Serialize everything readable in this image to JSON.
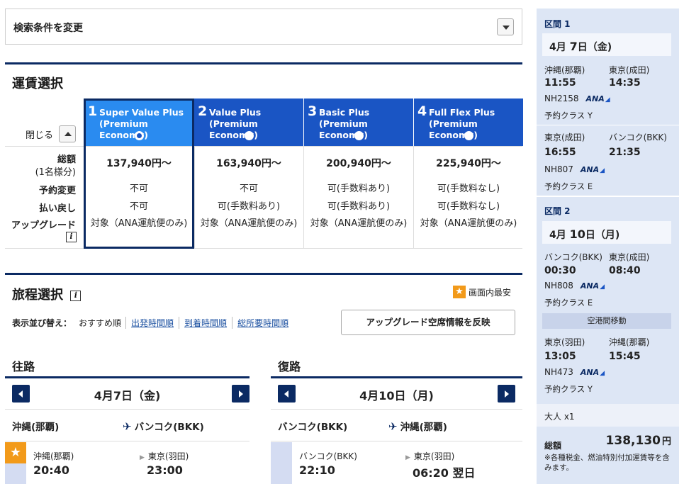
{
  "search": {
    "label": "検索条件を変更"
  },
  "fare_section": {
    "title": "運賃選択",
    "close_label": "閉じる",
    "row_labels": [
      "総額",
      "(1名様分)",
      "予約変更",
      "払い戻し",
      "アップグレード"
    ],
    "fares": [
      {
        "num": "1",
        "name": "Super Value Plus (Premium Economy)",
        "price": "137,940円〜",
        "change": "不可",
        "refund": "不可",
        "upgrade": "対象（ANA運航便のみ)",
        "selected": true
      },
      {
        "num": "2",
        "name": "Value Plus (Premium Economy)",
        "price": "163,940円〜",
        "change": "不可",
        "refund": "可(手数料あり)",
        "upgrade": "対象（ANA運航便のみ)",
        "selected": false
      },
      {
        "num": "3",
        "name": "Basic Plus (Premium Economy)",
        "price": "200,940円〜",
        "change": "可(手数料あり)",
        "refund": "可(手数料あり)",
        "upgrade": "対象（ANA運航便のみ)",
        "selected": false
      },
      {
        "num": "4",
        "name": "Full Flex Plus (Premium Economy)",
        "price": "225,940円〜",
        "change": "可(手数料なし)",
        "refund": "可(手数料なし)",
        "upgrade": "対象（ANA運航便のみ)",
        "selected": false
      }
    ]
  },
  "itinerary": {
    "title": "旅程選択",
    "cheapest_label": "画面内最安",
    "sort_label": "表示並び替え：",
    "sort_current": "おすすめ順",
    "sort_links": [
      "出発時間順",
      "到着時間順",
      "総所要時間順"
    ],
    "upgrade_button": "アップグレード空席情報を反映",
    "outbound": {
      "title": "往路",
      "date": "4月7日（金)",
      "from": "沖縄(那覇)",
      "to": "バンコク(BKK)",
      "flight": {
        "dep_city": "沖縄(那覇)",
        "arr_city": "東京(羽田)",
        "dep_time": "20:40",
        "arr_time": "23:00"
      }
    },
    "inbound": {
      "title": "復路",
      "date": "4月10日（月)",
      "from": "バンコク(BKK)",
      "to": "沖縄(那覇)",
      "flight": {
        "dep_city": "バンコク(BKK)",
        "arr_city": "東京(羽田)",
        "dep_time": "22:10",
        "arr_time": "06:20 翌日"
      }
    }
  },
  "summary": {
    "seg1": {
      "head": "区間 1",
      "month": "4月",
      "day": "7",
      "day_suffix": "日（金)",
      "legs": [
        {
          "from_city": "沖縄(那覇)",
          "to_city": "東京(成田)",
          "dep": "11:55",
          "arr": "14:35",
          "flight": "NH2158",
          "cls": "予約クラス Y"
        },
        {
          "from_city": "東京(成田)",
          "to_city": "バンコク(BKK)",
          "dep": "16:55",
          "arr": "21:35",
          "flight": "NH807",
          "cls": "予約クラス E"
        }
      ]
    },
    "seg2": {
      "head": "区間 2",
      "month": "4月",
      "day": "10",
      "day_suffix": "日（月)",
      "legs": [
        {
          "from_city": "バンコク(BKK)",
          "to_city": "東京(成田)",
          "dep": "00:30",
          "arr": "08:40",
          "flight": "NH808",
          "cls": "予約クラス E"
        },
        {
          "from_city": "東京(羽田)",
          "to_city": "沖縄(那覇)",
          "dep": "13:05",
          "arr": "15:45",
          "flight": "NH473",
          "cls": "予約クラス Y"
        }
      ],
      "transfer": "空港間移動"
    },
    "airline": "ANA",
    "pax": "大人 x1",
    "total_label": "総額",
    "total_value": "138,130",
    "currency": "円",
    "note": "※各種税金、燃油特別付加運賃等を含みます。"
  }
}
